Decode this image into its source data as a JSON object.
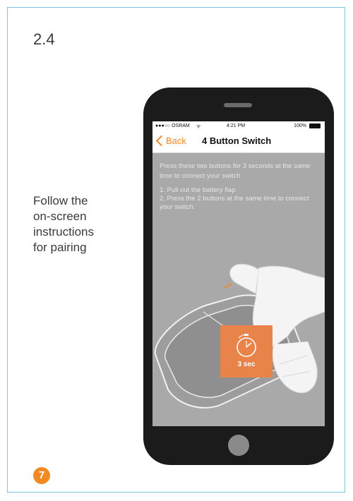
{
  "step": {
    "number": "2.4"
  },
  "instruction": {
    "text": "Follow the\non-screen\ninstructions\nfor pairing"
  },
  "page": {
    "badge": "7"
  },
  "phone": {
    "statusbar": {
      "carrier": "●●●○○ OSRAM",
      "time": "4:21 PM",
      "battery": "100%"
    },
    "navbar": {
      "back_label": "Back",
      "title": "4 Button Switch"
    },
    "prompt": "Press these two buttons for 3 seconds at the same time to connect your switch",
    "steps": [
      "1. Pull out the battery flap",
      "2. Press the 2 buttons at the same time to connect your switch."
    ],
    "timer_label": "3 sec"
  },
  "colors": {
    "accent": "#f08a24",
    "frame_border": "#7ec9d9",
    "screen_bg": "#a9a9a9",
    "timer_box": "#e8844a",
    "phone_body": "#1b1b1b"
  },
  "icons": [
    "wifi-icon",
    "battery-icon",
    "back-chevron-icon",
    "stopwatch-icon",
    "hand-icon",
    "switch-device-icon"
  ]
}
